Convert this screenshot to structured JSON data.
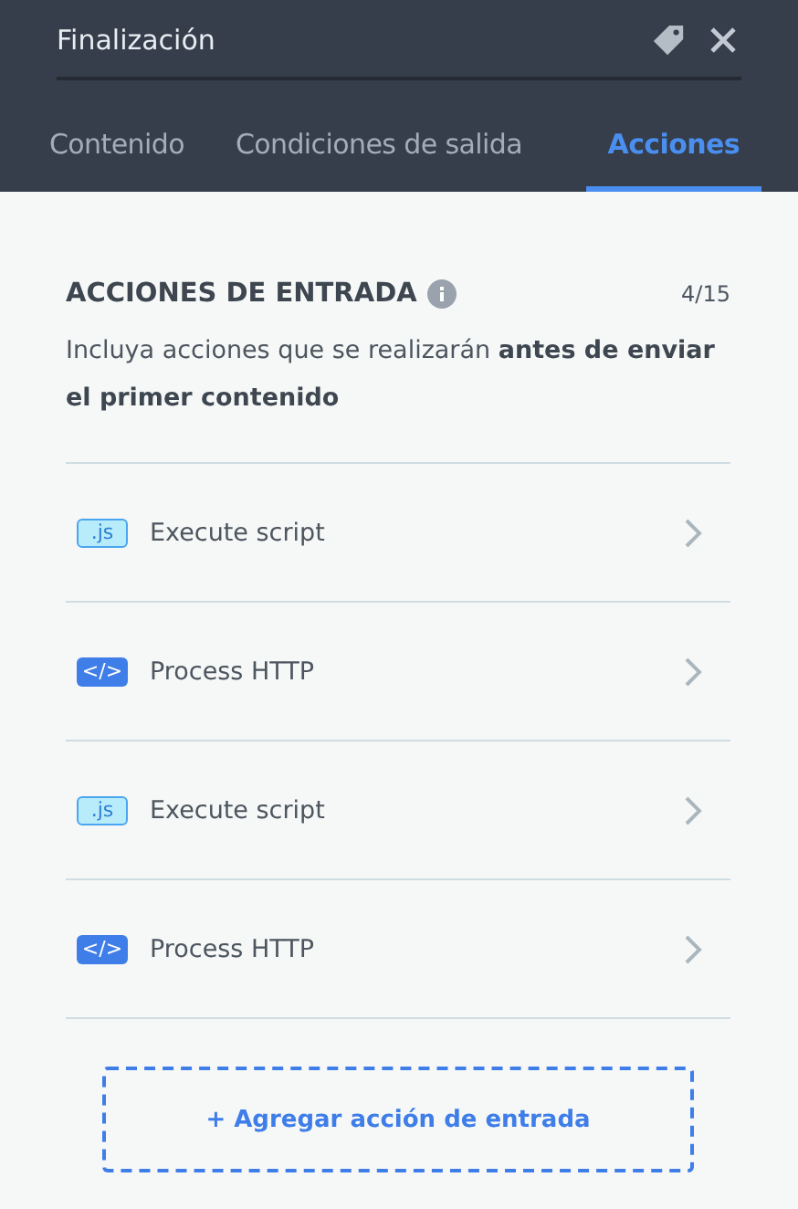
{
  "header": {
    "title": "Finalización"
  },
  "tabs": [
    {
      "label": "Contenido",
      "selected": false
    },
    {
      "label": "Condiciones de salida",
      "selected": false
    },
    {
      "label": "Acciones",
      "selected": true
    }
  ],
  "section": {
    "title": "ACCIONES DE ENTRADA",
    "count": "4/15",
    "description": "Incluya acciones que se realizarán **antes de enviar el primer contenido**"
  },
  "actions": [
    {
      "kind": "script",
      "badge": ".js",
      "label": "Execute script"
    },
    {
      "kind": "http",
      "badge": "</>",
      "label": "Process HTTP"
    },
    {
      "kind": "script",
      "badge": ".js",
      "label": "Execute script"
    },
    {
      "kind": "http",
      "badge": "</>",
      "label": "Process HTTP"
    }
  ],
  "add_button": "+ Agregar acción de entrada"
}
